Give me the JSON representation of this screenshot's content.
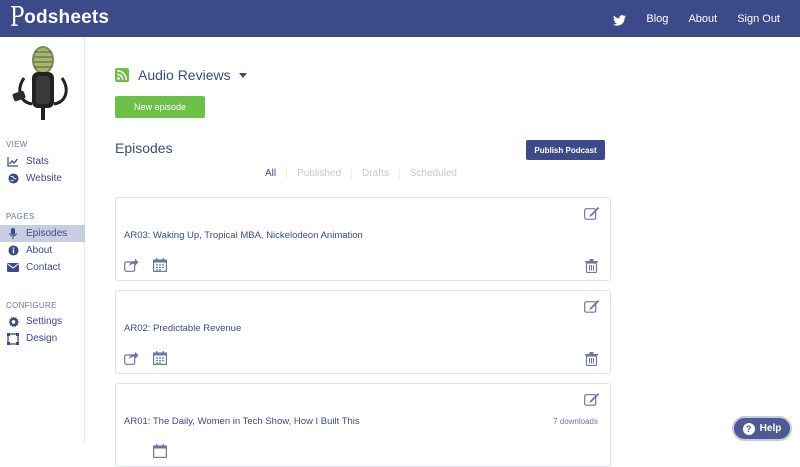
{
  "app": {
    "logo_mark": "P",
    "logo_text": "odsheets"
  },
  "topnav": {
    "blog": "Blog",
    "about": "About",
    "signout": "Sign Out",
    "icon": "twitter-icon"
  },
  "sidebar": {
    "view_heading": "VIEW",
    "pages_heading": "PAGES",
    "configure_heading": "CONFIGURE",
    "items": [
      {
        "label": "Stats",
        "icon": "chart-icon"
      },
      {
        "label": "Website",
        "icon": "globe-icon"
      },
      {
        "label": "Episodes",
        "icon": "microphone-icon",
        "active": true
      },
      {
        "label": "About",
        "icon": "info-icon"
      },
      {
        "label": "Contact",
        "icon": "envelope-icon"
      },
      {
        "label": "Settings",
        "icon": "gear-icon"
      },
      {
        "label": "Design",
        "icon": "design-icon"
      }
    ]
  },
  "main": {
    "show_title": "Audio Reviews",
    "new_episode_label": "New episode",
    "episodes_title": "Episodes",
    "publish_label": "Publish Podcast",
    "tabs": [
      {
        "label": "All"
      },
      {
        "label": "Published"
      },
      {
        "label": "Drafts"
      },
      {
        "label": "Scheduled"
      }
    ],
    "episodes": [
      {
        "title": "AR03: Waking Up, Tropical MBA, Nickelodeon Animation",
        "downloads": ""
      },
      {
        "title": "AR02: Predictable Revenue",
        "downloads": ""
      },
      {
        "title": "AR01: The Daily, Women in Tech Show, How I Built This",
        "downloads": "7 downloads"
      }
    ]
  },
  "help": {
    "label": "Help"
  },
  "colors": {
    "primary": "#3c4a8a",
    "accent_green": "#6dc046",
    "sidebar_active": "#c9cde2"
  }
}
